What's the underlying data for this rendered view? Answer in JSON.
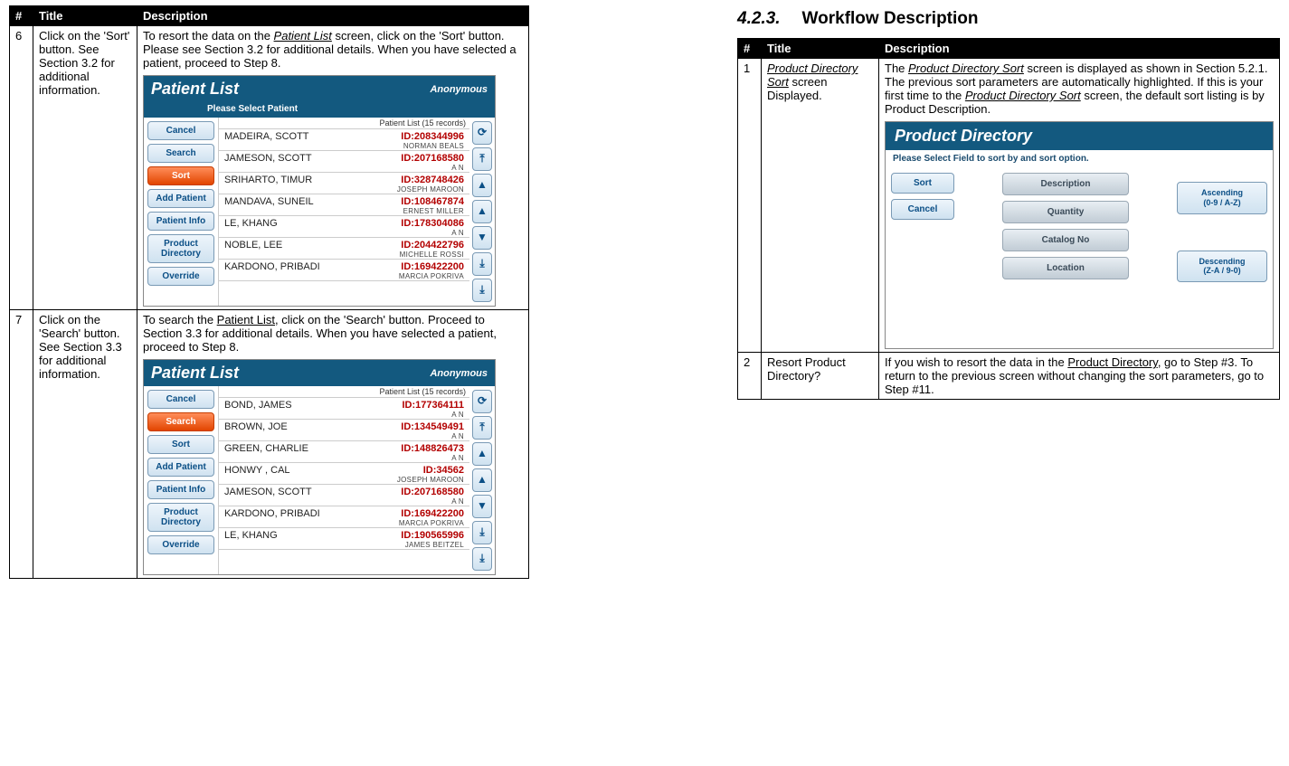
{
  "left": {
    "headers": {
      "num": "#",
      "title": "Title",
      "desc": "Description"
    },
    "rows": [
      {
        "num": "6",
        "title": "Click on the 'Sort' button.  See Section 3.2 for additional information.",
        "desc_pre": "To resort the data on the ",
        "desc_link": "Patient List",
        "desc_post": " screen, click on the 'Sort' button.  Please see Section 3.2 for additional details.   When you have selected a patient, proceed to Step 8.",
        "app": {
          "title": "Patient List",
          "anon": "Anonymous",
          "sub": "Please Select Patient",
          "countlabel": "Patient List (15 records)",
          "sidebar": [
            {
              "label": "Cancel",
              "active": false
            },
            {
              "label": "Search",
              "active": false
            },
            {
              "label": "Sort",
              "active": true
            },
            {
              "label": "Add Patient",
              "active": false
            },
            {
              "label": "Patient Info",
              "active": false
            },
            {
              "label": "Product Directory",
              "active": false
            },
            {
              "label": "Override",
              "active": false
            }
          ],
          "rows": [
            {
              "name": "MADEIRA, SCOTT",
              "id": "ID:208344996",
              "sub": "NORMAN BEALS"
            },
            {
              "name": "JAMESON, SCOTT",
              "id": "ID:207168580",
              "sub": "A N"
            },
            {
              "name": "SRIHARTO, TIMUR",
              "id": "ID:328748426",
              "sub": "JOSEPH MAROON"
            },
            {
              "name": "MANDAVA, SUNEIL",
              "id": "ID:108467874",
              "sub": "ERNEST MILLER"
            },
            {
              "name": "LE, KHANG",
              "id": "ID:178304086",
              "sub": "A N"
            },
            {
              "name": "NOBLE, LEE",
              "id": "ID:204422796",
              "sub": "MICHELLE ROSSI"
            },
            {
              "name": "KARDONO, PRIBADI",
              "id": "ID:169422200",
              "sub": "MARCIA POKRIVA"
            }
          ],
          "scroll": [
            "⟳",
            "⤒",
            "▲",
            "▲",
            "▼",
            "⤓",
            "⤓"
          ]
        }
      },
      {
        "num": "7",
        "title": "Click on the 'Search' button.  See Section 3.3 for additional information.",
        "desc_pre": "To search the ",
        "desc_link": "Patient List",
        "desc_post": ", click on the 'Search' button.  Proceed to Section 3.3 for additional details.  When you have selected a patient, proceed to Step 8.",
        "app": {
          "title": "Patient List",
          "anon": "Anonymous",
          "sub": "",
          "countlabel": "Patient List (15 records)",
          "sidebar": [
            {
              "label": "Cancel",
              "active": false
            },
            {
              "label": "Search",
              "active": true
            },
            {
              "label": "Sort",
              "active": false
            },
            {
              "label": "Add Patient",
              "active": false
            },
            {
              "label": "Patient Info",
              "active": false
            },
            {
              "label": "Product Directory",
              "active": false
            },
            {
              "label": "Override",
              "active": false
            }
          ],
          "rows": [
            {
              "name": "BOND, JAMES",
              "id": "ID:177364111",
              "sub": "A N"
            },
            {
              "name": "BROWN, JOE",
              "id": "ID:134549491",
              "sub": "A N"
            },
            {
              "name": "GREEN, CHARLIE",
              "id": "ID:148826473",
              "sub": "A N"
            },
            {
              "name": "HONWY , CAL",
              "id": "ID:34562",
              "sub": "JOSEPH MAROON"
            },
            {
              "name": "JAMESON, SCOTT",
              "id": "ID:207168580",
              "sub": "A N"
            },
            {
              "name": "KARDONO, PRIBADI",
              "id": "ID:169422200",
              "sub": "MARCIA POKRIVA"
            },
            {
              "name": "LE, KHANG",
              "id": "ID:190565996",
              "sub": "JAMES BEITZEL"
            }
          ],
          "scroll": [
            "⟳",
            "⤒",
            "▲",
            "▲",
            "▼",
            "⤓",
            "⤓"
          ]
        }
      }
    ]
  },
  "right": {
    "heading_num": "4.2.3.",
    "heading_text": "Workflow Description",
    "headers": {
      "num": "#",
      "title": "Title",
      "desc": "Description"
    },
    "rows": [
      {
        "num": "1",
        "title_pre": "",
        "title_link": "Product Directory Sort",
        "title_post": " screen Displayed.",
        "desc_pre": "The ",
        "desc_link1": "Product Directory Sort",
        "desc_mid": " screen is displayed as shown in Section 5.2.1.  The previous sort parameters are automatically highlighted.  If this is your first time to the ",
        "desc_link2": "Product Directory Sort",
        "desc_post": " screen, the default sort listing is by Product Description.",
        "pd": {
          "title": "Product Directory",
          "sub": "Please Select Field to sort by and sort option.",
          "left": [
            "Sort",
            "Cancel"
          ],
          "mid": [
            "Description",
            "Quantity",
            "Catalog No",
            "Location"
          ],
          "right": [
            {
              "l1": "Ascending",
              "l2": "(0-9 / A-Z)"
            },
            {
              "l1": "Descending",
              "l2": "(Z-A / 9-0)"
            }
          ]
        }
      },
      {
        "num": "2",
        "title_plain": "Resort Product Directory?",
        "desc_pre": "If you wish to resort the data in the ",
        "desc_link1": "Product Directory",
        "desc_post": ", go to Step #3.  To return to the previous screen without changing the sort parameters, go to Step #11."
      }
    ]
  }
}
